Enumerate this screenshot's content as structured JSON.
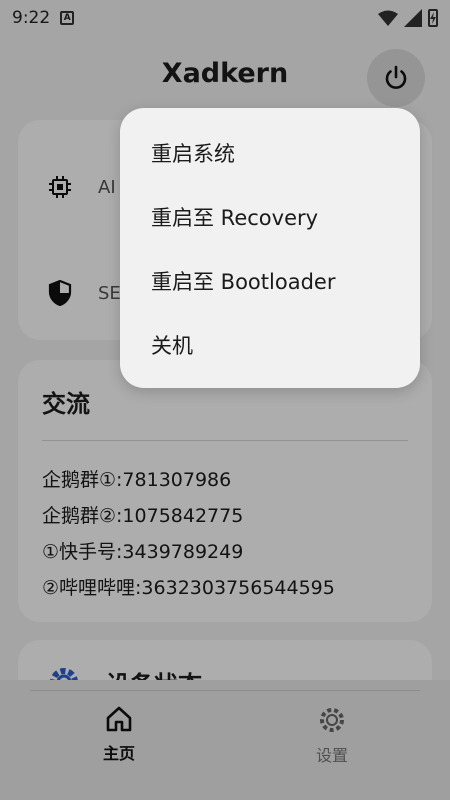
{
  "status_bar": {
    "time": "9:22",
    "notification_letter": "A"
  },
  "header": {
    "title": "Xadkern"
  },
  "info_card": {
    "row1_label": "AI",
    "row2_label": "SE"
  },
  "communication_card": {
    "title": "交流",
    "lines": [
      "企鹅群①:781307986",
      "企鹅群②:1075842775",
      "①快手号:3439789249",
      "②哔哩哔哩:3632303756544595"
    ]
  },
  "device_card": {
    "title": "设备状态"
  },
  "bottom_nav": {
    "home_label": "主页",
    "settings_label": "设置"
  },
  "power_menu": {
    "items": [
      "重启系统",
      "重启至 Recovery",
      "重启至 Bootloader",
      "关机"
    ]
  },
  "colors": {
    "scrim": "#000000",
    "menu_bg": "#f1f1f1",
    "card_bg": "#ffffff"
  }
}
